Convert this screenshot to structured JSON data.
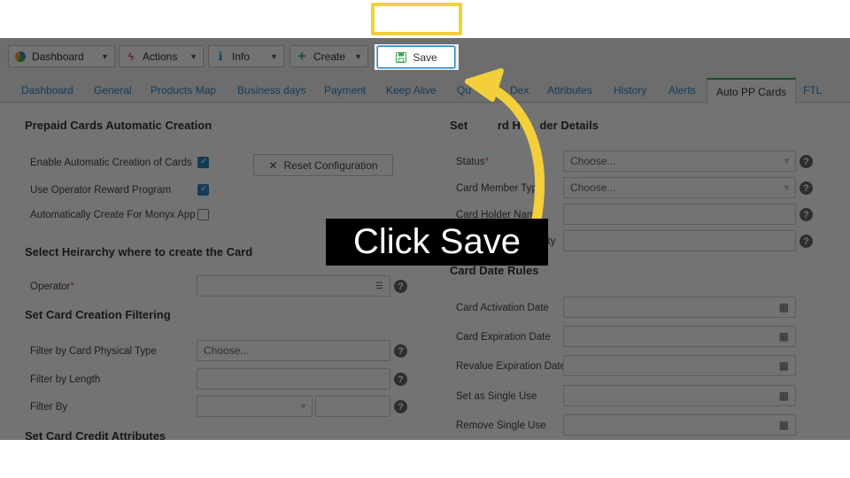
{
  "toolbar": {
    "buttons": [
      {
        "label": "Dashboard",
        "icon": "pie-chart-icon"
      },
      {
        "label": "Actions",
        "icon": "lightning-icon"
      },
      {
        "label": "Info",
        "icon": "info-icon"
      },
      {
        "label": "Create",
        "icon": "plus-icon"
      }
    ],
    "save_label": "Save"
  },
  "tabs": [
    "Dashboard",
    "General",
    "Products Map",
    "Business days",
    "Payment",
    "Keep Alive",
    "Qu",
    "Dex",
    "Attributes",
    "History",
    "Alerts",
    "Auto PP Cards",
    "FTL"
  ],
  "left": {
    "section1_title": "Prepaid Cards Automatic Creation",
    "enable_label": "Enable Automatic Creation of Cards",
    "reward_label": "Use Operator Reward Program",
    "monyx_label": "Automatically Create For Monyx App",
    "reset_label": "Reset Configuration",
    "section2_title": "Select Heirarchy where to create the Card",
    "operator_label": "Operator",
    "section3_title": "Set Card Creation Filtering",
    "physical_label": "Filter by Card Physical Type",
    "physical_placeholder": "Choose...",
    "length_label": "Filter by Length",
    "filterby_label": "Filter By",
    "section4_title": "Set Card Credit Attributes"
  },
  "right": {
    "section1_title_a": "Set",
    "section1_title_b": "rd H",
    "section1_title_c": "der Details",
    "status_label": "Status",
    "status_value": "Choose...",
    "member_label": "Card Member Typ",
    "member_value": "Choose...",
    "holder_label": "Card Holder Nam",
    "ity_label": "ity",
    "section2_title": "Card Date Rules",
    "activation_label": "Card Activation Date",
    "expiration_label": "Card Expiration Date",
    "revalue_label": "Revalue Expiration Date",
    "single_label": "Set as Single Use",
    "remove_label": "Remove Single Use"
  },
  "callout": "Click Save",
  "colors": {
    "highlight": "#f2cf3b",
    "active_tab": "#35a853",
    "link": "#2d86c8"
  }
}
